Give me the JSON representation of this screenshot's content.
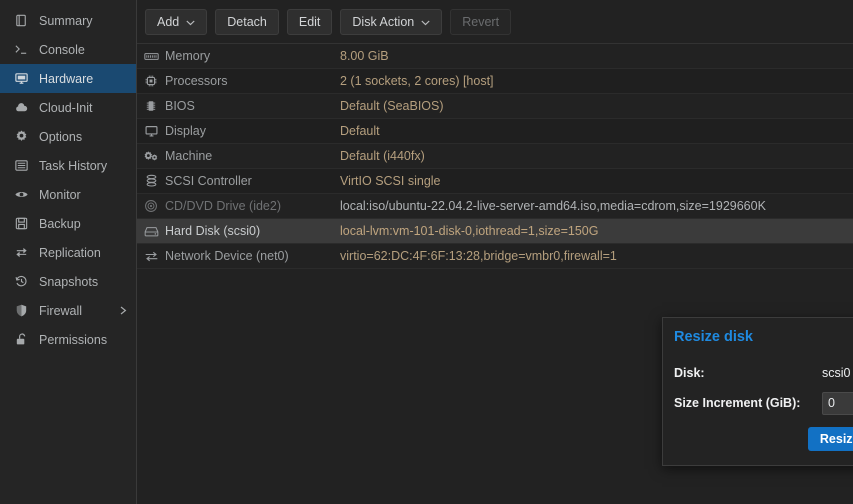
{
  "sidebar": {
    "items": [
      {
        "label": "Summary",
        "icon": "book-icon",
        "active": false,
        "submenu": false
      },
      {
        "label": "Console",
        "icon": "terminal-icon",
        "active": false,
        "submenu": false
      },
      {
        "label": "Hardware",
        "icon": "monitor-icon",
        "active": true,
        "submenu": false
      },
      {
        "label": "Cloud-Init",
        "icon": "cloud-icon",
        "active": false,
        "submenu": false
      },
      {
        "label": "Options",
        "icon": "gear-icon",
        "active": false,
        "submenu": false
      },
      {
        "label": "Task History",
        "icon": "list-icon",
        "active": false,
        "submenu": false
      },
      {
        "label": "Monitor",
        "icon": "eye-icon",
        "active": false,
        "submenu": false
      },
      {
        "label": "Backup",
        "icon": "floppy-icon",
        "active": false,
        "submenu": false
      },
      {
        "label": "Replication",
        "icon": "replication-icon",
        "active": false,
        "submenu": false
      },
      {
        "label": "Snapshots",
        "icon": "history-icon",
        "active": false,
        "submenu": false
      },
      {
        "label": "Firewall",
        "icon": "shield-icon",
        "active": false,
        "submenu": true
      },
      {
        "label": "Permissions",
        "icon": "unlock-icon",
        "active": false,
        "submenu": false
      }
    ]
  },
  "toolbar": {
    "buttons": [
      {
        "label": "Add",
        "caret": true,
        "disabled": false
      },
      {
        "label": "Detach",
        "caret": false,
        "disabled": false
      },
      {
        "label": "Edit",
        "caret": false,
        "disabled": false
      },
      {
        "label": "Disk Action",
        "caret": true,
        "disabled": false
      },
      {
        "label": "Revert",
        "caret": false,
        "disabled": true
      }
    ]
  },
  "hardware": {
    "rows": [
      {
        "icon": "memory-icon",
        "key": "Memory",
        "value": "8.00 GiB",
        "selected": false,
        "dim": false
      },
      {
        "icon": "cpu-icon",
        "key": "Processors",
        "value": "2 (1 sockets, 2 cores) [host]",
        "selected": false,
        "dim": false
      },
      {
        "icon": "bios-icon",
        "key": "BIOS",
        "value": "Default (SeaBIOS)",
        "selected": false,
        "dim": false
      },
      {
        "icon": "display-icon",
        "key": "Display",
        "value": "Default",
        "selected": false,
        "dim": false
      },
      {
        "icon": "machine-icon",
        "key": "Machine",
        "value": "Default (i440fx)",
        "selected": false,
        "dim": false
      },
      {
        "icon": "scsi-icon",
        "key": "SCSI Controller",
        "value": "VirtIO SCSI single",
        "selected": false,
        "dim": false
      },
      {
        "icon": "cdrom-icon",
        "key": "CD/DVD Drive (ide2)",
        "value": "local:iso/ubuntu-22.04.2-live-server-amd64.iso,media=cdrom,size=1929660K",
        "selected": false,
        "dim": true
      },
      {
        "icon": "harddisk-icon",
        "key": "Hard Disk (scsi0)",
        "value": "local-lvm:vm-101-disk-0,iothread=1,size=150G",
        "selected": true,
        "dim": false
      },
      {
        "icon": "network-icon",
        "key": "Network Device (net0)",
        "value": "virtio=62:DC:4F:6F:13:28,bridge=vmbr0,firewall=1",
        "selected": false,
        "dim": false
      }
    ]
  },
  "dialog": {
    "title": "Resize disk",
    "close_icon": "close-circle-icon",
    "disk_label": "Disk:",
    "disk_value": "scsi0",
    "size_label": "Size Increment (GiB):",
    "size_value": "0",
    "submit_label": "Resize disk",
    "accent_color": "#1271c4",
    "title_color": "#1f8ae0"
  }
}
